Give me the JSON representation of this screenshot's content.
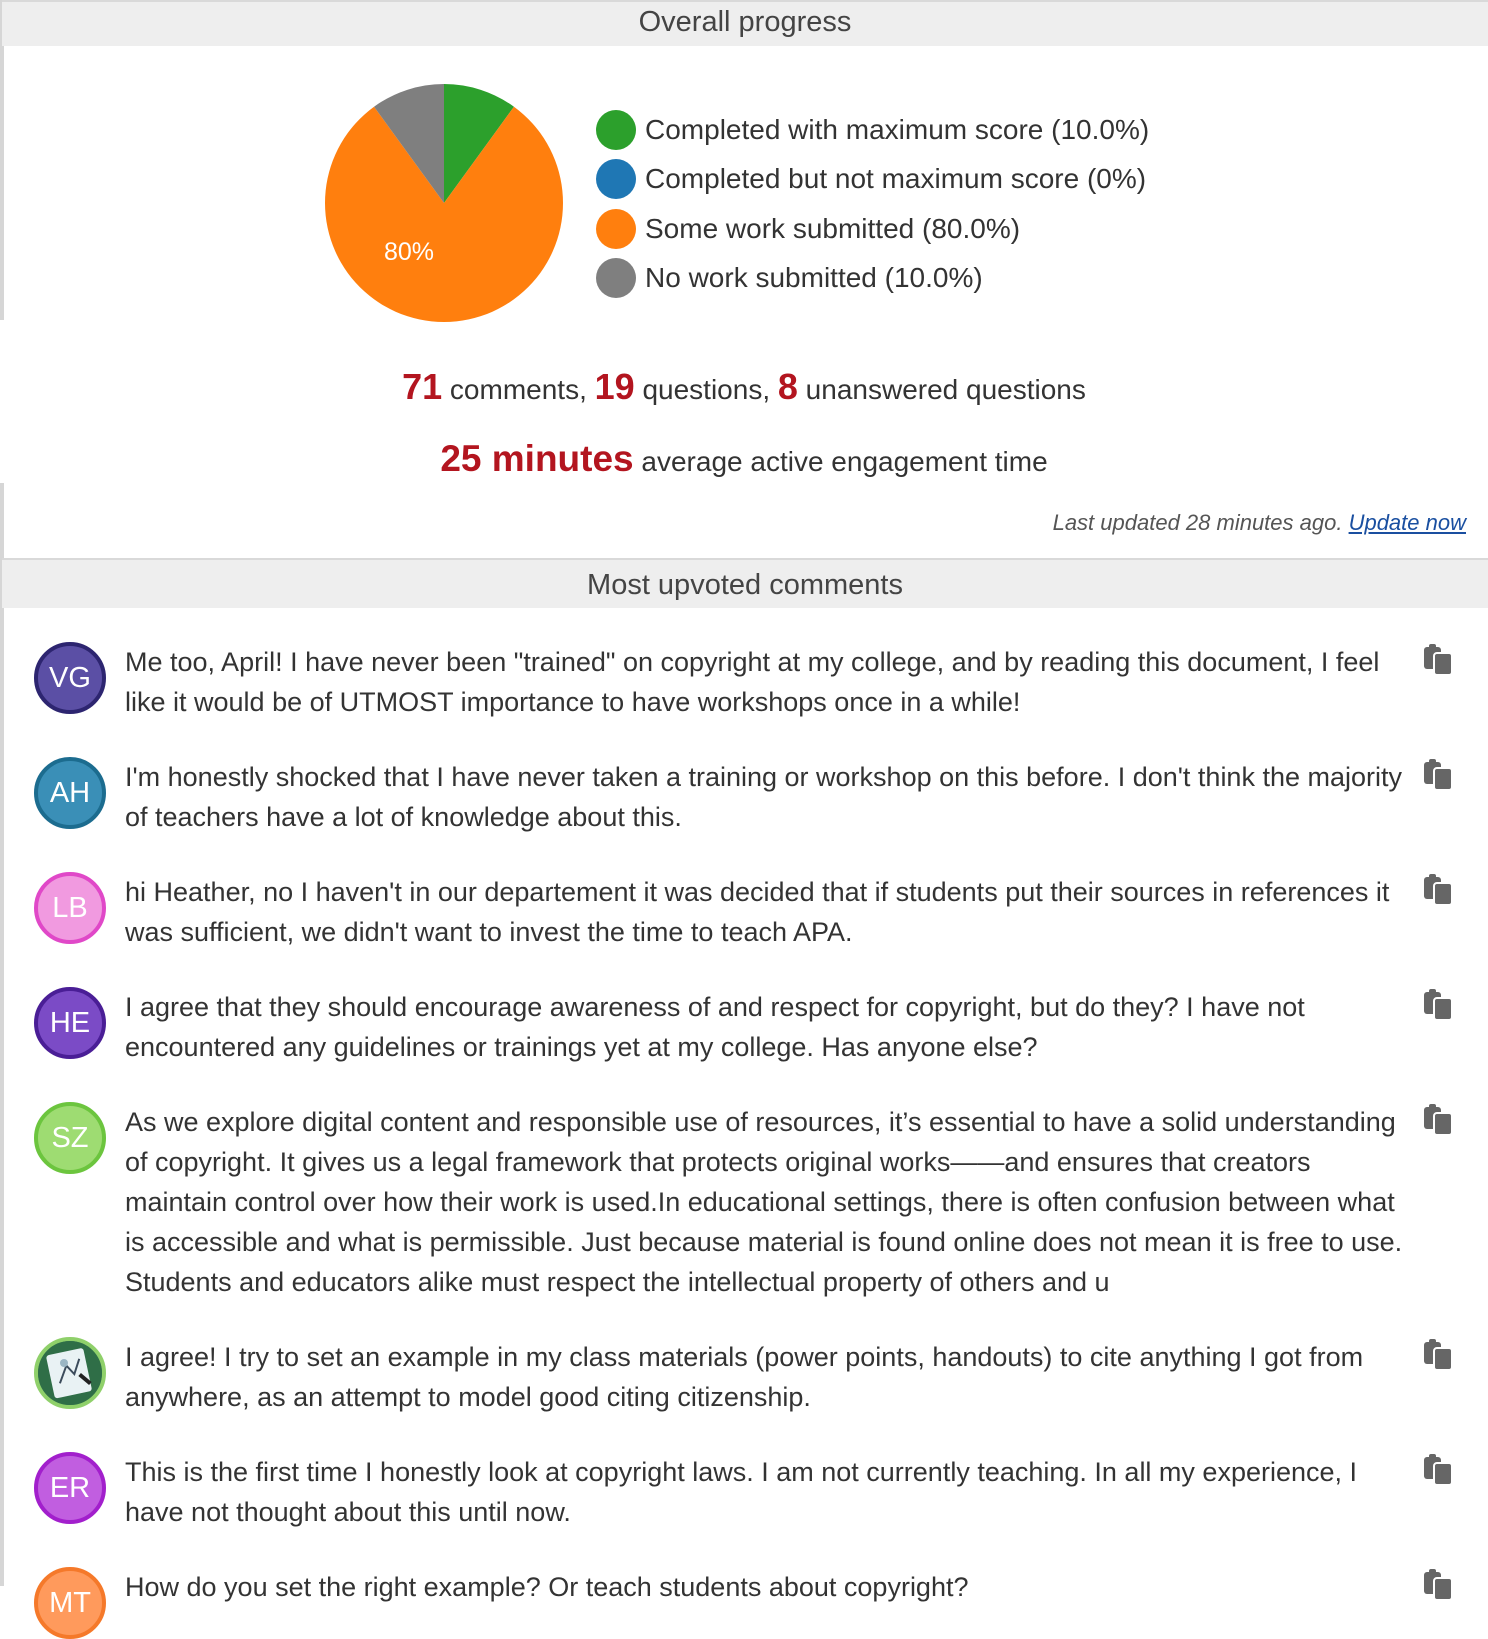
{
  "progress": {
    "header": "Overall progress",
    "chart_data": {
      "type": "pie",
      "slices": [
        {
          "label": "Completed with maximum score (10.0%)",
          "value": 10.0,
          "color": "#2ca02c"
        },
        {
          "label": "Completed but not maximum score (0%)",
          "value": 0.0,
          "color": "#1f77b4"
        },
        {
          "label": "Some work submitted (80.0%)",
          "value": 80.0,
          "color": "#ff7f0e"
        },
        {
          "label": "No work submitted (10.0%)",
          "value": 10.0,
          "color": "#7f7f7f"
        }
      ],
      "slice_label": "80%",
      "legend_position": "right"
    }
  },
  "stats": {
    "comments_count": "71",
    "comments_label": " comments, ",
    "questions_count": "19",
    "questions_label": " questions, ",
    "unanswered_count": "8",
    "unanswered_label": " unanswered questions",
    "engagement_value": "25 minutes",
    "engagement_label": " average active engagement time"
  },
  "last_updated": {
    "text": "Last updated 28 minutes ago. ",
    "link": "Update now"
  },
  "upvoted": {
    "header": "Most upvoted comments",
    "comments": [
      {
        "initials": "VG",
        "avatar_bg": "#5b4fa5",
        "avatar_border": "#2d2570",
        "text": "Me too, April! I have never been \"trained\" on copyright at my college, and by reading this document, I feel like it would be of UTMOST importance to have workshops once in a while!"
      },
      {
        "initials": "AH",
        "avatar_bg": "#3a8fb7",
        "avatar_border": "#1c6c8f",
        "text": "I'm honestly shocked that I have never taken a training or workshop on this before. I don't think the majority of teachers have a lot of knowledge about this."
      },
      {
        "initials": "LB",
        "avatar_bg": "#f19ae0",
        "avatar_border": "#e048c8",
        "text": "hi Heather, no I haven't in our departement it was decided that if students put their sources in refer­ences it was sufficient, we didn't want to invest the time to teach APA."
      },
      {
        "initials": "HE",
        "avatar_bg": "#7b4bc6",
        "avatar_border": "#4a1e96",
        "text": "I agree that they should encourage awareness of and respect for copyright, but do they? I have not encountered any guidelines or trainings yet at my college. Has anyone else?"
      },
      {
        "initials": "SZ",
        "avatar_bg": "#9edc72",
        "avatar_border": "#6cc53e",
        "text": "As we explore digital content and responsible use of resources, it’s essential to have a solid under­standing of copyright. It gives us a legal framework that protects original works——and ensures that creators maintain control over how their work is used.In educational settings, there is often confu­sion between what is accessible and what is permissible. Just because material is found online does not mean it is free to use. Students and educators alike must respect the intellectual property of others and u"
      },
      {
        "initials": "",
        "avatar_bg": "#3f8a5a",
        "avatar_border": "#8fd06a",
        "text": "I agree! I try to set an example in my class materials (power points, handouts) to cite anything I got from anywhere, as an attempt to model good citing citizenship."
      },
      {
        "initials": "ER",
        "avatar_bg": "#c15ee0",
        "avatar_border": "#a21fcc",
        "text": "This is the first time I honestly look at copyright laws. I am not currently teaching. In all my experi­ence, I have not thought about this until now."
      },
      {
        "initials": "MT",
        "avatar_bg": "#ff9a5c",
        "avatar_border": "#f5792a",
        "text": "How do you set the right example? Or teach students about copyright?"
      }
    ]
  }
}
